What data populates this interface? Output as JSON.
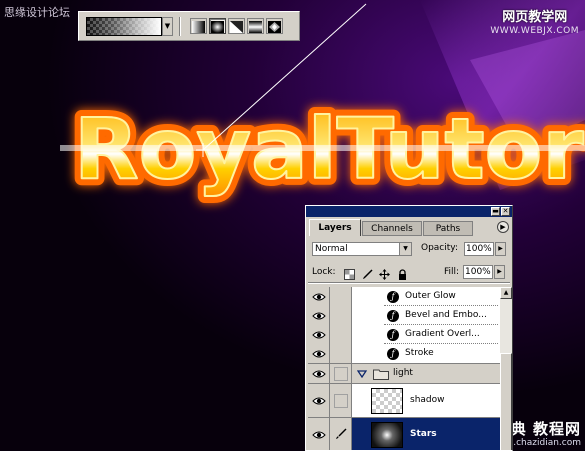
{
  "watermarks": {
    "top_left": "思缘设计论坛",
    "top_right_main": "网页教学网",
    "top_right_sub": "WWW.WEBJX.COM",
    "bottom_right_main": "查字典 教程网",
    "bottom_right_sub": "jiaocheng.chazidian.com"
  },
  "canvas": {
    "artwork_text": "RoyalTutor",
    "background_color": "#0a0014",
    "accent_purple": "#7a1aa8",
    "text_colors": {
      "outer": "#ff7a00",
      "inner": "#ffd21a",
      "glow": "#ffffff"
    }
  },
  "gradient_options": {
    "types": [
      "linear-gradient",
      "radial-gradient",
      "angle-gradient",
      "reflected-gradient",
      "diamond-gradient"
    ],
    "active_index": 1
  },
  "layers_panel": {
    "tabs": [
      "Layers",
      "Channels",
      "Paths"
    ],
    "active_tab": 0,
    "blend_mode": "Normal",
    "opacity_label": "Opacity:",
    "opacity_value": "100%",
    "lock_label": "Lock:",
    "fill_label": "Fill:",
    "fill_value": "100%",
    "effects": [
      "Outer Glow",
      "Bevel and Embo...",
      "Gradient Overl...",
      "Stroke"
    ],
    "group": {
      "name": "light",
      "expanded": true
    },
    "layers": [
      {
        "name": "shadow",
        "selected": false
      },
      {
        "name": "Stars",
        "selected": true
      }
    ]
  }
}
